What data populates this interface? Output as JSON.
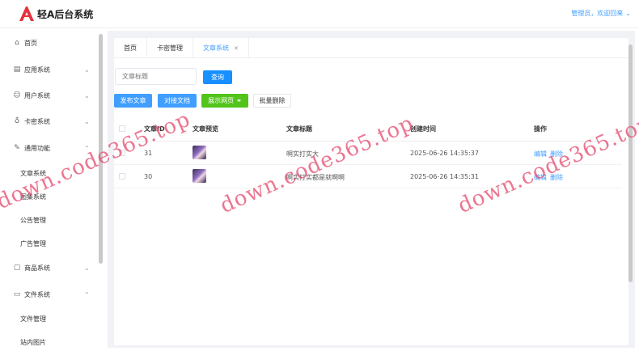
{
  "header": {
    "app_title": "轻A后台系统",
    "user_label": "管理员，欢迎回来",
    "brand_color": "#e5323c"
  },
  "sidebar": {
    "items": [
      {
        "label": "首页",
        "icon": "home-icon"
      },
      {
        "label": "应用系统",
        "icon": "app-icon"
      },
      {
        "label": "用户系统",
        "icon": "user-icon"
      },
      {
        "label": "卡密系统",
        "icon": "key-icon"
      },
      {
        "label": "通用功能",
        "icon": "edit-icon"
      },
      {
        "label": "商品系统",
        "icon": "bag-icon"
      },
      {
        "label": "文件系统",
        "icon": "folder-icon"
      }
    ],
    "general_sub": [
      "文章系统",
      "图集系统",
      "公告管理",
      "广告管理"
    ],
    "file_sub": [
      "文件管理",
      "站内图片"
    ]
  },
  "tabs": [
    {
      "label": "首页"
    },
    {
      "label": "卡密管理"
    },
    {
      "label": "文章系统"
    }
  ],
  "search": {
    "placeholder": "文章标题",
    "query_label": "查询"
  },
  "toolbar": {
    "publish_label": "发布文章",
    "api_doc_label": "对接文档",
    "demo_label": "展示网页",
    "batch_delete_label": "批量删除"
  },
  "table": {
    "columns": [
      "文章ID",
      "文章预览",
      "文章标题",
      "创建时间",
      "操作"
    ],
    "rows": [
      {
        "id": "31",
        "title": "啊实打实大",
        "created": "2025-06-26 14:35:37"
      },
      {
        "id": "30",
        "title": "啊实打实都是就啊啊",
        "created": "2025-06-26 14:35:31"
      }
    ],
    "edit_label": "编辑",
    "delete_label": "删除"
  },
  "watermark": "down.code365.top"
}
